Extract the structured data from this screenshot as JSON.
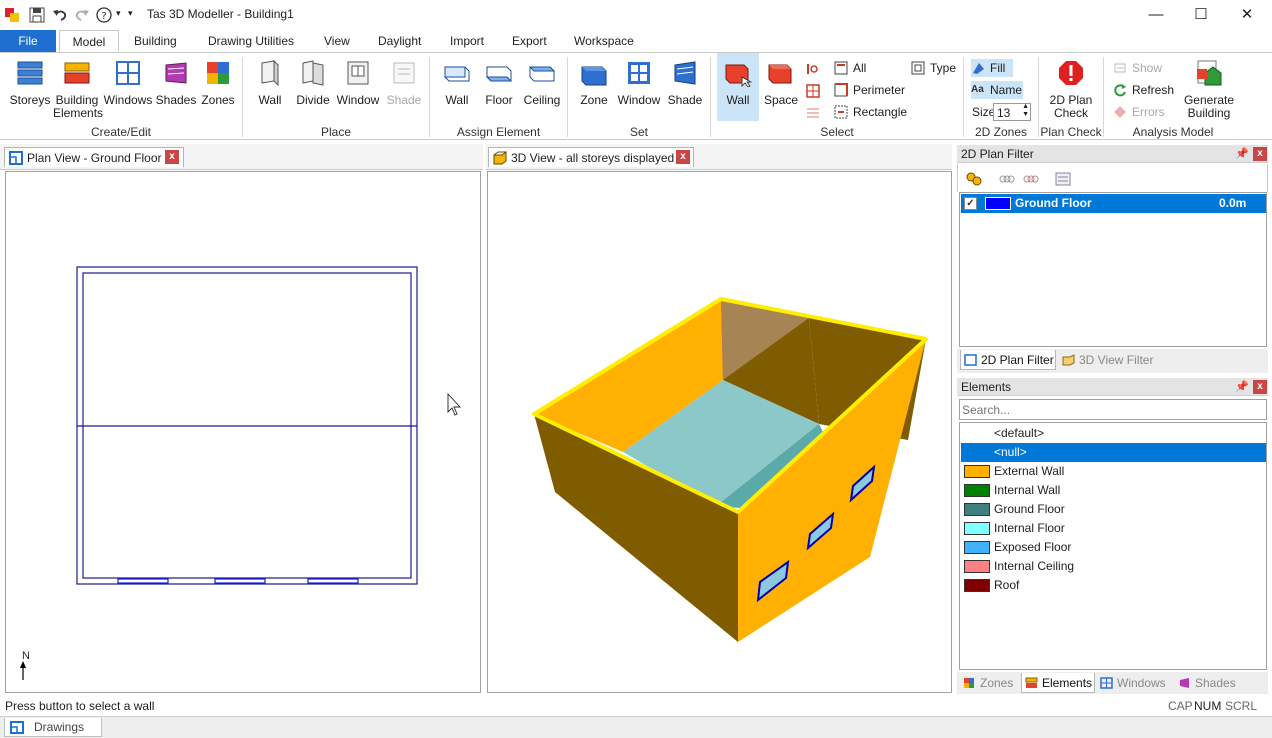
{
  "window": {
    "title": "Tas 3D Modeller - Building1",
    "minimize": "—",
    "maximize": "☐",
    "close": "✕"
  },
  "ribbon_tabs": [
    "File",
    "Model",
    "Building",
    "Drawing Utilities",
    "View",
    "Daylight",
    "Import",
    "Export",
    "Workspace"
  ],
  "ribbon": {
    "create_edit": {
      "label": "Create/Edit",
      "storeys": "Storeys",
      "building_elements": "Building\nElements",
      "windows": "Windows",
      "shades": "Shades",
      "zones": "Zones"
    },
    "place": {
      "label": "Place",
      "wall": "Wall",
      "divide": "Divide",
      "window": "Window",
      "shade": "Shade"
    },
    "assign_element": {
      "label": "Assign Element",
      "wall": "Wall",
      "floor": "Floor",
      "ceiling": "Ceiling"
    },
    "set": {
      "label": "Set",
      "zone": "Zone",
      "window": "Window",
      "shade": "Shade"
    },
    "select": {
      "label": "Select",
      "wall": "Wall",
      "space": "Space",
      "all": "All",
      "perimeter": "Perimeter",
      "rectangle": "Rectangle",
      "type": "Type"
    },
    "zones_2d": {
      "label": "2D Zones",
      "fill": "Fill",
      "name": "Name",
      "size_label": "Size",
      "size_value": "13"
    },
    "plan_check": {
      "label": "Plan Check",
      "button": "2D Plan\nCheck"
    },
    "analysis_model": {
      "label": "Analysis Model",
      "show": "Show",
      "refresh": "Refresh",
      "errors": "Errors",
      "generate": "Generate\nBuilding"
    }
  },
  "plan_view": {
    "tab": "Plan View - Ground Floor",
    "north": "N"
  },
  "view_3d": {
    "tab": "3D View - all storeys displayed"
  },
  "plan_filter": {
    "title": "2D Plan Filter",
    "rows": [
      {
        "name": "Ground Floor",
        "value": "0.0m",
        "color": "#0000ff",
        "checked": true
      }
    ],
    "tabs": [
      "2D Plan Filter",
      "3D View Filter"
    ]
  },
  "elements": {
    "title": "Elements",
    "search_placeholder": "Search...",
    "items": [
      {
        "name": "<default>",
        "color": ""
      },
      {
        "name": "<null>",
        "color": "",
        "selected": true
      },
      {
        "name": "External Wall",
        "color": "#ffb000"
      },
      {
        "name": "Internal Wall",
        "color": "#008000"
      },
      {
        "name": "Ground Floor",
        "color": "#3f7f7f"
      },
      {
        "name": "Internal Floor",
        "color": "#80ffff"
      },
      {
        "name": "Exposed Floor",
        "color": "#40b0ff"
      },
      {
        "name": "Internal Ceiling",
        "color": "#ff8080"
      },
      {
        "name": "Roof",
        "color": "#800000"
      }
    ],
    "tabs": [
      "Zones",
      "Elements",
      "Windows",
      "Shades"
    ]
  },
  "status": {
    "message": "Press button to select a wall",
    "cap": "CAP",
    "num": "NUM",
    "scrl": "SCRL"
  },
  "bottom_tab": "Drawings",
  "colors": {
    "accent": "#1e6fd0",
    "selection": "#0078d7",
    "wall_face": "#ffb000",
    "wall_shadow": "#7f5c00"
  }
}
